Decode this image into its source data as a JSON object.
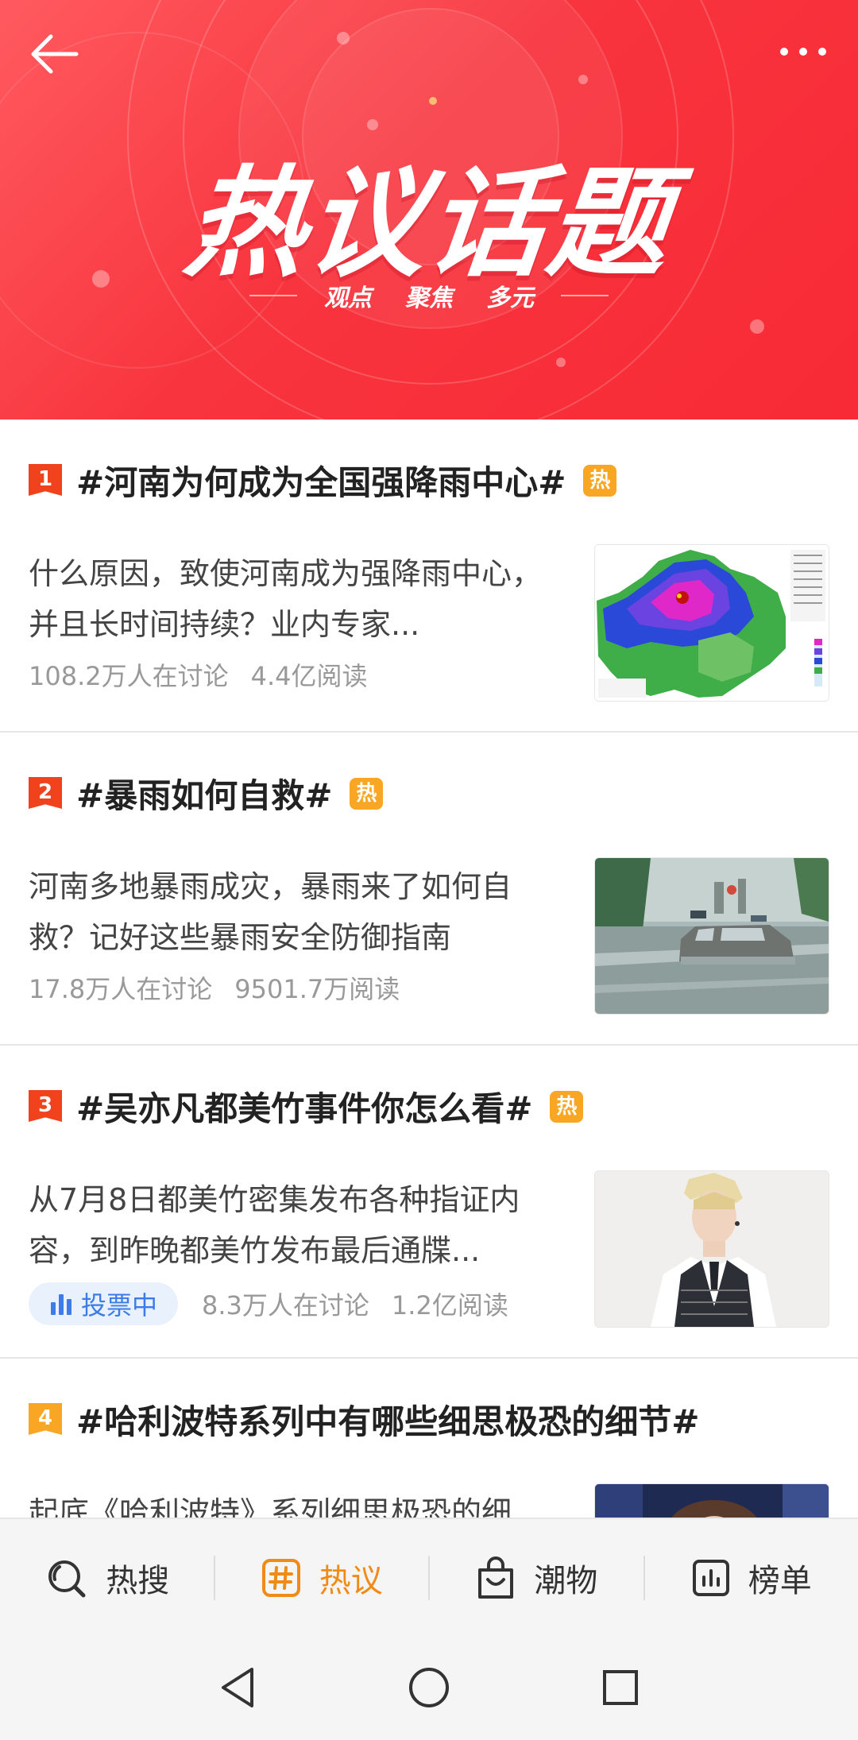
{
  "header": {
    "title": "热议话题",
    "subtitle_words": [
      "观点",
      "聚焦",
      "多元"
    ]
  },
  "colors": {
    "banner": "#f8343e",
    "rank_top": "#f0421d",
    "rank_fourth": "#f8a623",
    "hot_badge": "#f8a623",
    "active_tab": "#f08b17",
    "vote_text": "#3d7be7"
  },
  "topics": [
    {
      "rank": "1",
      "title": "#河南为何成为全国强降雨中心#",
      "badge": "热",
      "desc": "什么原因，致使河南成为强降雨中心，并且长时间持续？业内专家...",
      "discuss": "108.2万人在讨论",
      "reads": "4.4亿阅读",
      "image": "rainfall-map"
    },
    {
      "rank": "2",
      "title": "#暴雨如何自救#",
      "badge": "热",
      "desc": "河南多地暴雨成灾，暴雨来了如何自救？记好这些暴雨安全防御指南",
      "discuss": "17.8万人在讨论",
      "reads": "9501.7万阅读",
      "image": "flooded-street"
    },
    {
      "rank": "3",
      "title": "#吴亦凡都美竹事件你怎么看#",
      "badge": "热",
      "desc": "从7月8日都美竹密集发布各种指证内容，到昨晚都美竹发布最后通牒...",
      "vote": "投票中",
      "discuss": "8.3万人在讨论",
      "reads": "1.2亿阅读",
      "image": "person-portrait"
    },
    {
      "rank": "4",
      "title": "#哈利波特系列中有哪些细思极恐的细节#",
      "desc": "起底《哈利波特》系列细思极恐的细",
      "image": "movie-poster"
    }
  ],
  "tabs": [
    {
      "label": "热搜",
      "icon": "hot-search-icon"
    },
    {
      "label": "热议",
      "icon": "hashtag-icon",
      "active": true
    },
    {
      "label": "潮物",
      "icon": "shopping-bag-icon"
    },
    {
      "label": "榜单",
      "icon": "chart-icon"
    }
  ]
}
